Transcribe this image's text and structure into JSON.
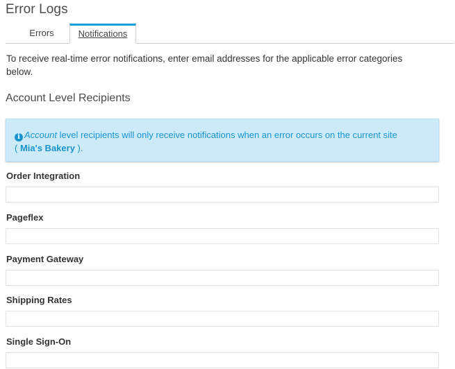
{
  "page": {
    "title": "Error Logs"
  },
  "tabs": [
    {
      "label": "Errors",
      "active": false
    },
    {
      "label": "Notifications",
      "active": true
    }
  ],
  "intro_text": "To receive real-time error notifications, enter email addresses for the applicable error categories below.",
  "section": {
    "heading": "Account Level Recipients"
  },
  "alert": {
    "icon": "info-circle-icon",
    "emphasis": "Account",
    "text_before_site": " level recipients will only receive notifications when an error occurs on the current site",
    "open_paren": "( ",
    "site_name": "Mia's Bakery",
    "close_paren": " ).",
    "color": "#1a95cf",
    "background": "#cdeaf8"
  },
  "fields": [
    {
      "label": "Order Integration",
      "value": ""
    },
    {
      "label": "Pageflex",
      "value": ""
    },
    {
      "label": "Payment Gateway",
      "value": ""
    },
    {
      "label": "Shipping Rates",
      "value": ""
    },
    {
      "label": "Single Sign-On",
      "value": ""
    }
  ],
  "colors": {
    "accent": "#1aa0dc"
  }
}
